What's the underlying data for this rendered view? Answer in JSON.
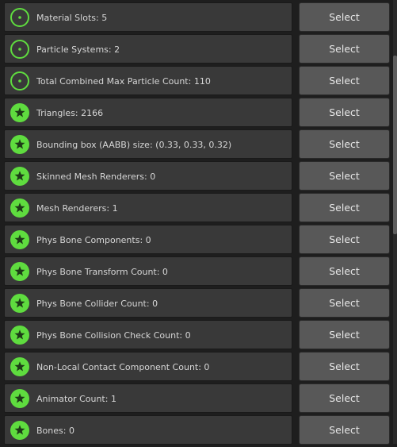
{
  "accent_color": "#5fdc3f",
  "select_label": "Select",
  "items": [
    {
      "label": "Material Slots: 5",
      "icon": "info-circle-icon"
    },
    {
      "label": "Particle Systems: 2",
      "icon": "info-circle-icon"
    },
    {
      "label": "Total Combined Max Particle Count: 110",
      "icon": "info-circle-icon"
    },
    {
      "label": "Triangles: 2166",
      "icon": "star-icon"
    },
    {
      "label": "Bounding box (AABB) size: (0.33, 0.33, 0.32)",
      "icon": "star-icon"
    },
    {
      "label": "Skinned Mesh Renderers: 0",
      "icon": "star-icon"
    },
    {
      "label": "Mesh Renderers: 1",
      "icon": "star-icon"
    },
    {
      "label": "Phys Bone Components: 0",
      "icon": "star-icon"
    },
    {
      "label": "Phys Bone Transform Count: 0",
      "icon": "star-icon"
    },
    {
      "label": "Phys Bone Collider Count: 0",
      "icon": "star-icon"
    },
    {
      "label": "Phys Bone Collision Check Count: 0",
      "icon": "star-icon"
    },
    {
      "label": "Non-Local Contact Component Count: 0",
      "icon": "star-icon"
    },
    {
      "label": "Animator Count: 1",
      "icon": "star-icon"
    },
    {
      "label": "Bones: 0",
      "icon": "star-icon"
    }
  ]
}
